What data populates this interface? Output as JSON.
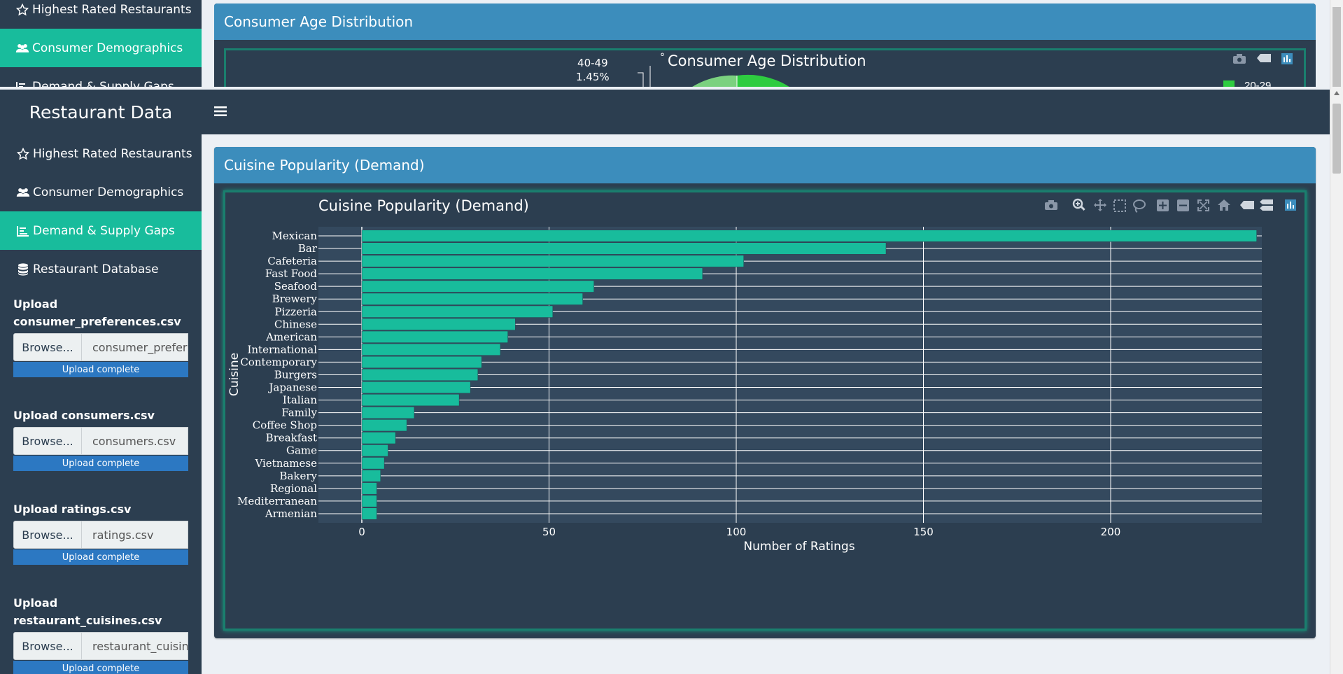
{
  "background_page": {
    "sidebar": {
      "items": [
        {
          "label": "Highest Rated Restaurants",
          "icon": "star-icon"
        },
        {
          "label": "Consumer Demographics",
          "icon": "users-icon",
          "active": true
        },
        {
          "label": "Demand & Supply Gaps",
          "icon": "bar-chart-icon"
        }
      ]
    },
    "box_title": "Consumer Age Distribution",
    "plot_title": "Consumer Age Distribution",
    "pie_label": {
      "category": "40-49",
      "percent": "1.45%"
    },
    "legend_first": "20-29"
  },
  "app": {
    "brand": "Restaurant Data",
    "menu_icon": "hamburger-icon"
  },
  "sidebar": {
    "items": [
      {
        "label": "Highest Rated Restaurants",
        "icon": "star-icon"
      },
      {
        "label": "Consumer Demographics",
        "icon": "users-icon"
      },
      {
        "label": "Demand & Supply Gaps",
        "icon": "bar-chart-icon",
        "active": true
      },
      {
        "label": "Restaurant Database",
        "icon": "database-icon"
      }
    ],
    "uploads": [
      {
        "label": "Upload consumer_preferences.csv",
        "browse": "Browse...",
        "filename": "consumer_preferences.csv",
        "status": "Upload complete"
      },
      {
        "label": "Upload consumers.csv",
        "browse": "Browse...",
        "filename": "consumers.csv",
        "status": "Upload complete"
      },
      {
        "label": "Upload ratings.csv",
        "browse": "Browse...",
        "filename": "ratings.csv",
        "status": "Upload complete"
      },
      {
        "label": "Upload restaurant_cuisines.csv",
        "browse": "Browse...",
        "filename": "restaurant_cuisines.csv",
        "status": "Upload complete"
      }
    ]
  },
  "box": {
    "title": "Cuisine Popularity (Demand)"
  },
  "colors": {
    "accent": "#18bc9c",
    "navy": "#2c3e50",
    "header_blue": "#3c8dbc",
    "plot_bg": "#34495e",
    "bar": "#18bc9c"
  },
  "chart_data": {
    "type": "bar",
    "orientation": "horizontal",
    "title": "Cuisine Popularity (Demand)",
    "xlabel": "Number of Ratings",
    "ylabel": "Cuisine",
    "xlim": [
      0,
      250
    ],
    "x_ticks": [
      0,
      50,
      100,
      150,
      200
    ],
    "grid": true,
    "categories": [
      "Mexican",
      "Bar",
      "Cafeteria",
      "Fast Food",
      "Seafood",
      "Brewery",
      "Pizzeria",
      "Chinese",
      "American",
      "International",
      "Contemporary",
      "Burgers",
      "Japanese",
      "Italian",
      "Family",
      "Coffee Shop",
      "Breakfast",
      "Game",
      "Vietnamese",
      "Bakery",
      "Regional",
      "Mediterranean",
      "Armenian"
    ],
    "values": [
      239,
      140,
      102,
      91,
      62,
      59,
      51,
      41,
      39,
      37,
      32,
      31,
      29,
      26,
      14,
      12,
      9,
      7,
      6,
      5,
      4,
      4,
      4
    ]
  }
}
